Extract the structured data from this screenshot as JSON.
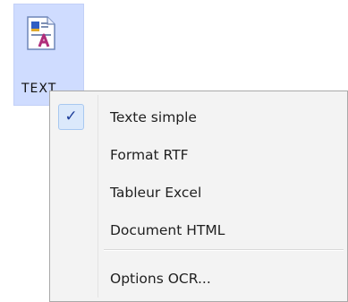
{
  "icon": {
    "label": "TEXT",
    "icon_name": "text-document-icon"
  },
  "menu": {
    "items": [
      {
        "label": "Texte simple",
        "checked": true
      },
      {
        "label": "Format RTF",
        "checked": false
      },
      {
        "label": "Tableur Excel",
        "checked": false
      },
      {
        "label": "Document HTML",
        "checked": false
      }
    ],
    "options_label": "Options OCR...",
    "check_glyph": "✓"
  },
  "colors": {
    "selection_bg": "#cfdcff",
    "menu_bg": "#f3f3f3",
    "check_color": "#1e3f9a"
  }
}
